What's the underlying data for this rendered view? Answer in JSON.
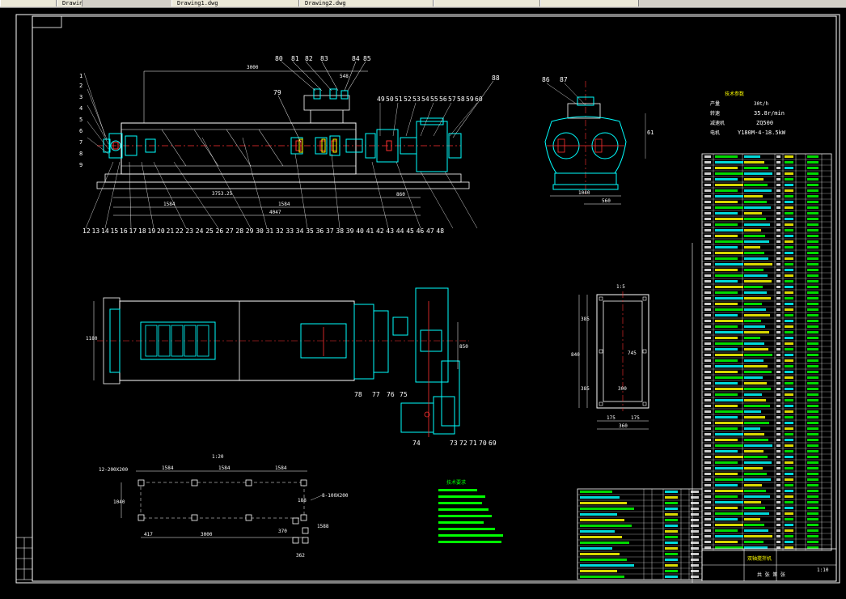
{
  "tabs": [
    "",
    "Drawing1.dwg",
    "Drawing2.dwg",
    "",
    "",
    "",
    ""
  ],
  "spec": {
    "title": "技术参数",
    "rows": [
      {
        "k": "产量",
        "v": "30t/h"
      },
      {
        "k": "转速",
        "v": "35.8r/min"
      },
      {
        "k": "减速机",
        "v": "ZQ500"
      },
      {
        "k": "电机",
        "v": "Y180M-4-18.5kW"
      }
    ]
  },
  "dims": {
    "d3000": "3000",
    "d548": "548",
    "d3753": "3753.25",
    "d1584a": "1584",
    "d1584b": "1584",
    "d4047": "4047",
    "d860": "860",
    "d1292": "1292",
    "d1040": "1040",
    "d560": "560",
    "d5": "1:5",
    "d300": "300",
    "d745": "745",
    "d175a": "175",
    "d175b": "175",
    "d360": "360",
    "d385a": "385",
    "d385b": "385",
    "d840": "840",
    "f1584a": "1584",
    "f1584b": "1584",
    "f1584c": "1584",
    "f3000": "3000",
    "f417": "417",
    "f1040": "1040",
    "f12": "12-200X200",
    "f8": "8-100X200",
    "fscale": "1:20",
    "f370": "370",
    "f188": "188",
    "f1588": "1588",
    "f362": "362"
  },
  "callouts_top": [
    "80",
    "81",
    "82",
    "83",
    "84",
    "85"
  ],
  "callouts_right": [
    "49",
    "50",
    "51",
    "52",
    "53",
    "54",
    "55",
    "56",
    "57",
    "58",
    "59",
    "60"
  ],
  "callouts_bottom": [
    "12",
    "13",
    "14",
    "15",
    "16",
    "17",
    "18",
    "19",
    "20",
    "21",
    "22",
    "23",
    "24",
    "25",
    "26",
    "27",
    "28",
    "29",
    "30",
    "31",
    "32",
    "33",
    "34",
    "35",
    "36",
    "37",
    "38",
    "39",
    "40",
    "41",
    "42",
    "43",
    "44",
    "45",
    "46",
    "47",
    "48"
  ],
  "callouts_misc": {
    "c79": "79",
    "c86": "86",
    "c87": "87",
    "c88": "88",
    "c61": "61",
    "c75": "75",
    "c76": "76",
    "c77": "77",
    "c78": "78",
    "c74": "74",
    "c69": "69",
    "c70": "70",
    "c71": "71",
    "c72": "72",
    "c73": "73"
  },
  "title_block": {
    "drawing_name": "双轴搅拌机",
    "sheet": "共 张 第 张",
    "scale": "1:10"
  },
  "notes_title": "技术要求"
}
